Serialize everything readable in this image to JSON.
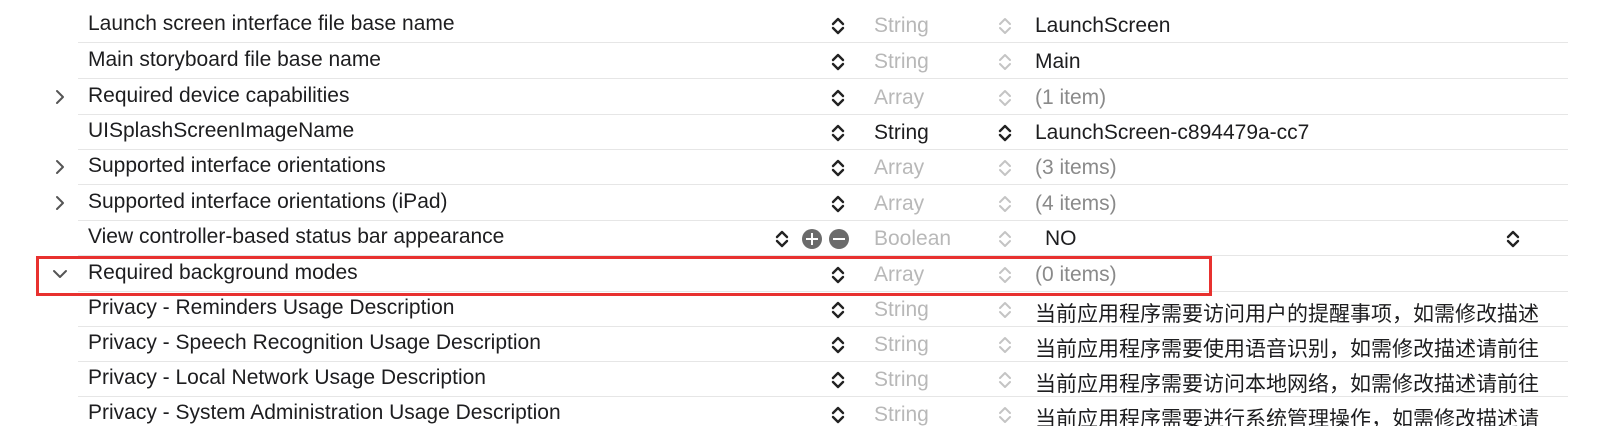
{
  "colors": {
    "highlight": "#e8312f",
    "type_inactive": "#b8b8b8",
    "text": "#1d1d1f"
  },
  "rows": [
    {
      "key": "Launch screen interface file base name",
      "type": "String",
      "value": "LaunchScreen",
      "disclosure": "none",
      "type_active": false,
      "value_muted": false
    },
    {
      "key": "Main storyboard file base name",
      "type": "String",
      "value": "Main",
      "disclosure": "none",
      "type_active": false,
      "value_muted": false
    },
    {
      "key": "Required device capabilities",
      "type": "Array",
      "value": "(1 item)",
      "disclosure": "collapsed",
      "type_active": false,
      "value_muted": true
    },
    {
      "key": "UISplashScreenImageName",
      "type": "String",
      "value": "LaunchScreen-c894479a-cc7",
      "disclosure": "none",
      "type_active": true,
      "value_muted": false
    },
    {
      "key": "Supported interface orientations",
      "type": "Array",
      "value": "(3 items)",
      "disclosure": "collapsed",
      "type_active": false,
      "value_muted": true
    },
    {
      "key": "Supported interface orientations (iPad)",
      "type": "Array",
      "value": "(4 items)",
      "disclosure": "collapsed",
      "type_active": false,
      "value_muted": true
    },
    {
      "key": "View controller-based status bar appearance",
      "type": "Boolean",
      "value": "NO",
      "disclosure": "none",
      "type_active": false,
      "value_muted": false,
      "selected": true
    },
    {
      "key": "Required background modes",
      "type": "Array",
      "value": "(0 items)",
      "disclosure": "expanded",
      "type_active": false,
      "value_muted": true,
      "highlighted": true
    },
    {
      "key": "Privacy - Reminders Usage Description",
      "type": "String",
      "value": "当前应用程序需要访问用户的提醒事项，如需修改描述",
      "disclosure": "none",
      "type_active": false,
      "value_muted": false
    },
    {
      "key": "Privacy - Speech Recognition Usage Description",
      "type": "String",
      "value": "当前应用程序需要使用语音识别，如需修改描述请前往",
      "disclosure": "none",
      "type_active": false,
      "value_muted": false
    },
    {
      "key": "Privacy - Local Network Usage Description",
      "type": "String",
      "value": "当前应用程序需要访问本地网络，如需修改描述请前往",
      "disclosure": "none",
      "type_active": false,
      "value_muted": false
    },
    {
      "key": "Privacy - System Administration Usage Description",
      "type": "String",
      "value": "当前应用程序需要进行系统管理操作，如需修改描述请",
      "disclosure": "none",
      "type_active": false,
      "value_muted": false
    }
  ]
}
